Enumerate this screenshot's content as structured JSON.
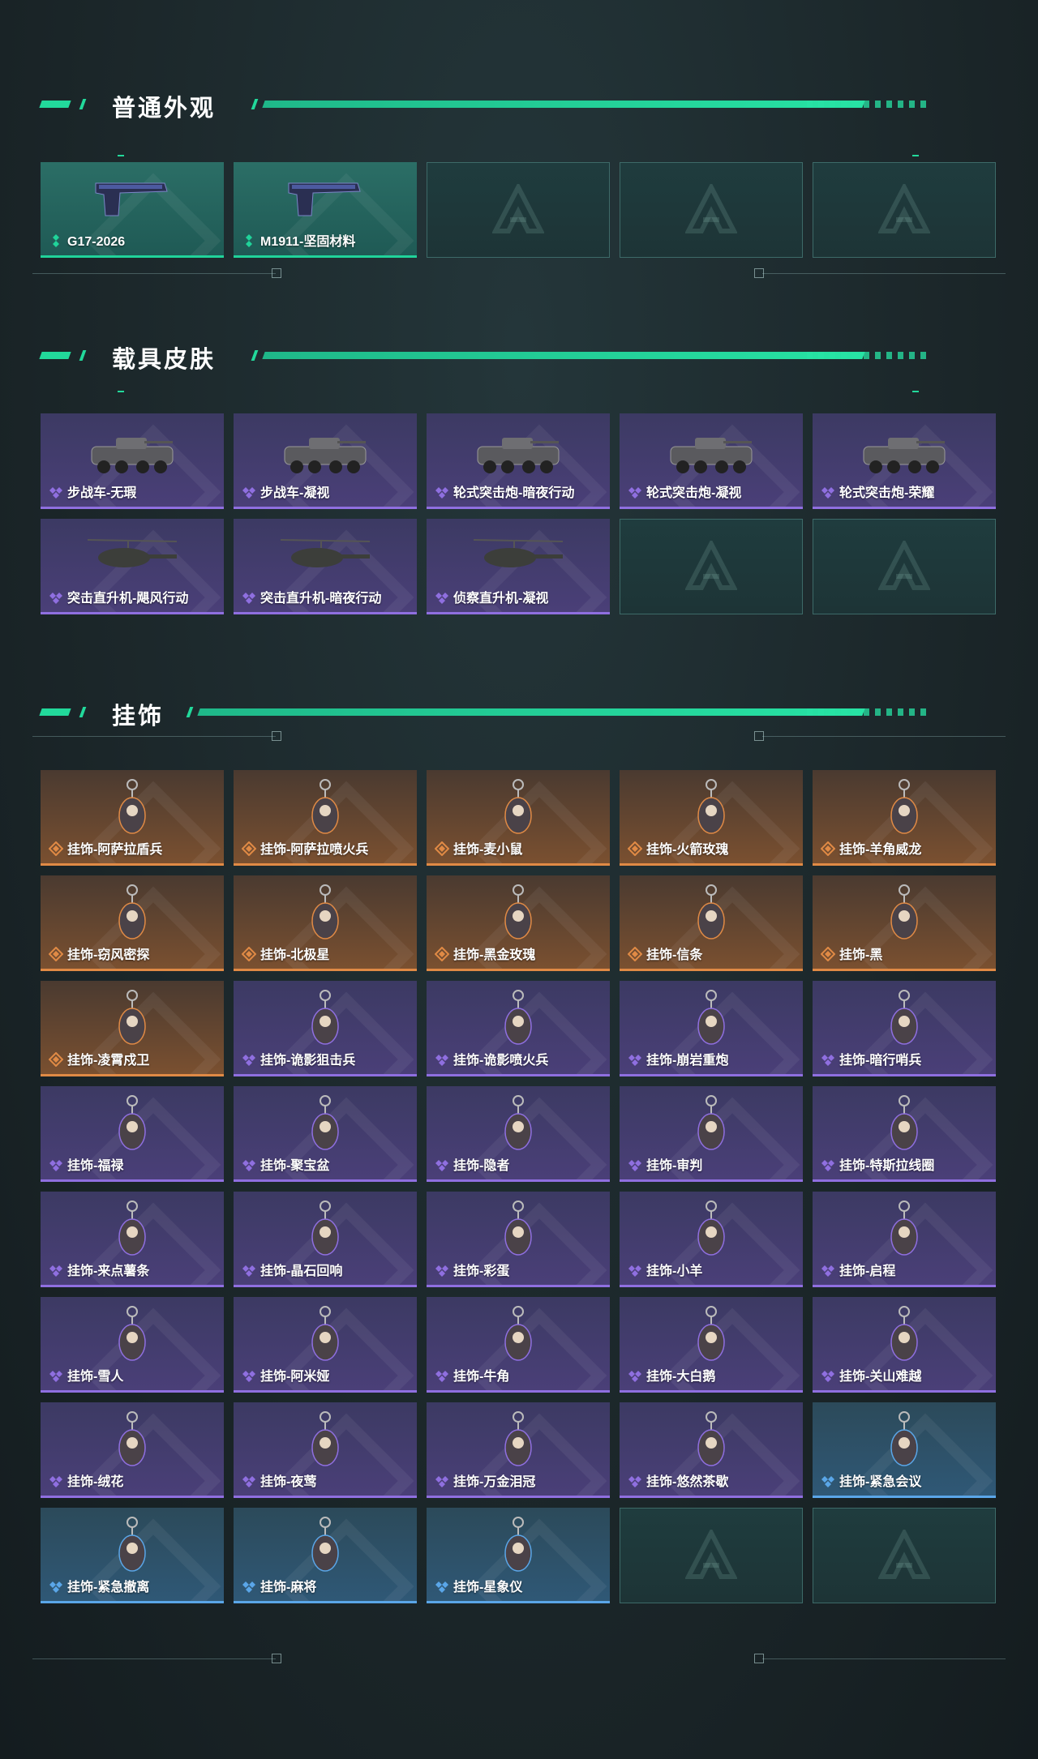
{
  "sections": [
    {
      "title": "普通外观",
      "items": [
        {
          "label": "G17-2026",
          "rarity": "green",
          "icon": "pistol-icon"
        },
        {
          "label": "M1911-坚固材料",
          "rarity": "green",
          "icon": "pistol-icon"
        },
        {
          "label": "",
          "rarity": "empty",
          "icon": "placeholder-logo-icon"
        },
        {
          "label": "",
          "rarity": "empty",
          "icon": "placeholder-logo-icon"
        },
        {
          "label": "",
          "rarity": "empty",
          "icon": "placeholder-logo-icon"
        }
      ]
    },
    {
      "title": "载具皮肤",
      "items": [
        {
          "label": "步战车-无瑕",
          "rarity": "purple",
          "icon": "ifv-icon"
        },
        {
          "label": "步战车-凝视",
          "rarity": "purple",
          "icon": "ifv-icon"
        },
        {
          "label": "轮式突击炮-暗夜行动",
          "rarity": "purple",
          "icon": "assault-vehicle-icon"
        },
        {
          "label": "轮式突击炮-凝视",
          "rarity": "purple",
          "icon": "assault-vehicle-icon"
        },
        {
          "label": "轮式突击炮-荣耀",
          "rarity": "purple",
          "icon": "assault-vehicle-icon"
        },
        {
          "label": "突击直升机-飓风行动",
          "rarity": "purple",
          "icon": "helicopter-icon"
        },
        {
          "label": "突击直升机-暗夜行动",
          "rarity": "purple",
          "icon": "helicopter-icon"
        },
        {
          "label": "侦察直升机-凝视",
          "rarity": "purple",
          "icon": "helicopter-icon"
        },
        {
          "label": "",
          "rarity": "empty",
          "icon": "placeholder-logo-icon"
        },
        {
          "label": "",
          "rarity": "empty",
          "icon": "placeholder-logo-icon"
        }
      ]
    },
    {
      "title": "挂饰",
      "items": [
        {
          "label": "挂饰-阿萨拉盾兵",
          "rarity": "orange",
          "icon": "charm-icon"
        },
        {
          "label": "挂饰-阿萨拉喷火兵",
          "rarity": "orange",
          "icon": "charm-icon"
        },
        {
          "label": "挂饰-麦小鼠",
          "rarity": "orange",
          "icon": "charm-icon"
        },
        {
          "label": "挂饰-火箭玫瑰",
          "rarity": "orange",
          "icon": "charm-icon"
        },
        {
          "label": "挂饰-羊角威龙",
          "rarity": "orange",
          "icon": "charm-icon"
        },
        {
          "label": "挂饰-窃风密探",
          "rarity": "orange",
          "icon": "charm-icon"
        },
        {
          "label": "挂饰-北极星",
          "rarity": "orange",
          "icon": "charm-icon"
        },
        {
          "label": "挂饰-黑金玫瑰",
          "rarity": "orange",
          "icon": "charm-icon"
        },
        {
          "label": "挂饰-信条",
          "rarity": "orange",
          "icon": "charm-icon"
        },
        {
          "label": "挂饰-黑",
          "rarity": "orange",
          "icon": "charm-icon"
        },
        {
          "label": "挂饰-凌霄戍卫",
          "rarity": "orange",
          "icon": "charm-icon"
        },
        {
          "label": "挂饰-诡影狙击兵",
          "rarity": "purple",
          "icon": "charm-icon"
        },
        {
          "label": "挂饰-诡影喷火兵",
          "rarity": "purple",
          "icon": "charm-icon"
        },
        {
          "label": "挂饰-崩岩重炮",
          "rarity": "purple",
          "icon": "charm-icon"
        },
        {
          "label": "挂饰-暗行哨兵",
          "rarity": "purple",
          "icon": "charm-icon"
        },
        {
          "label": "挂饰-福禄",
          "rarity": "purple",
          "icon": "charm-icon"
        },
        {
          "label": "挂饰-聚宝盆",
          "rarity": "purple",
          "icon": "charm-icon"
        },
        {
          "label": "挂饰-隐者",
          "rarity": "purple",
          "icon": "charm-icon"
        },
        {
          "label": "挂饰-审判",
          "rarity": "purple",
          "icon": "charm-icon"
        },
        {
          "label": "挂饰-特斯拉线圈",
          "rarity": "purple",
          "icon": "charm-icon"
        },
        {
          "label": "挂饰-来点薯条",
          "rarity": "purple",
          "icon": "charm-icon"
        },
        {
          "label": "挂饰-晶石回响",
          "rarity": "purple",
          "icon": "charm-icon"
        },
        {
          "label": "挂饰-彩蛋",
          "rarity": "purple",
          "icon": "charm-icon"
        },
        {
          "label": "挂饰-小羊",
          "rarity": "purple",
          "icon": "charm-icon"
        },
        {
          "label": "挂饰-启程",
          "rarity": "purple",
          "icon": "charm-icon"
        },
        {
          "label": "挂饰-雪人",
          "rarity": "purple",
          "icon": "charm-icon"
        },
        {
          "label": "挂饰-阿米娅",
          "rarity": "purple",
          "icon": "charm-icon"
        },
        {
          "label": "挂饰-牛角",
          "rarity": "purple",
          "icon": "charm-icon"
        },
        {
          "label": "挂饰-大白鹅",
          "rarity": "purple",
          "icon": "charm-icon"
        },
        {
          "label": "挂饰-关山难越",
          "rarity": "purple",
          "icon": "charm-icon"
        },
        {
          "label": "挂饰-绒花",
          "rarity": "purple",
          "icon": "charm-icon"
        },
        {
          "label": "挂饰-夜莺",
          "rarity": "purple",
          "icon": "charm-icon"
        },
        {
          "label": "挂饰-万金泪冠",
          "rarity": "purple",
          "icon": "charm-icon"
        },
        {
          "label": "挂饰-悠然茶歇",
          "rarity": "purple",
          "icon": "charm-icon"
        },
        {
          "label": "挂饰-紧急会议",
          "rarity": "blue",
          "icon": "charm-icon"
        },
        {
          "label": "挂饰-紧急撤离",
          "rarity": "blue",
          "icon": "charm-icon"
        },
        {
          "label": "挂饰-麻将",
          "rarity": "blue",
          "icon": "charm-icon"
        },
        {
          "label": "挂饰-星象仪",
          "rarity": "blue",
          "icon": "charm-icon"
        },
        {
          "label": "",
          "rarity": "empty",
          "icon": "placeholder-logo-icon"
        },
        {
          "label": "",
          "rarity": "empty",
          "icon": "placeholder-logo-icon"
        }
      ]
    }
  ],
  "colors": {
    "accent": "#22d99b",
    "green": "#20d39a",
    "purple": "#8f6fe0",
    "orange": "#e08a45",
    "blue": "#5aa6e8"
  }
}
